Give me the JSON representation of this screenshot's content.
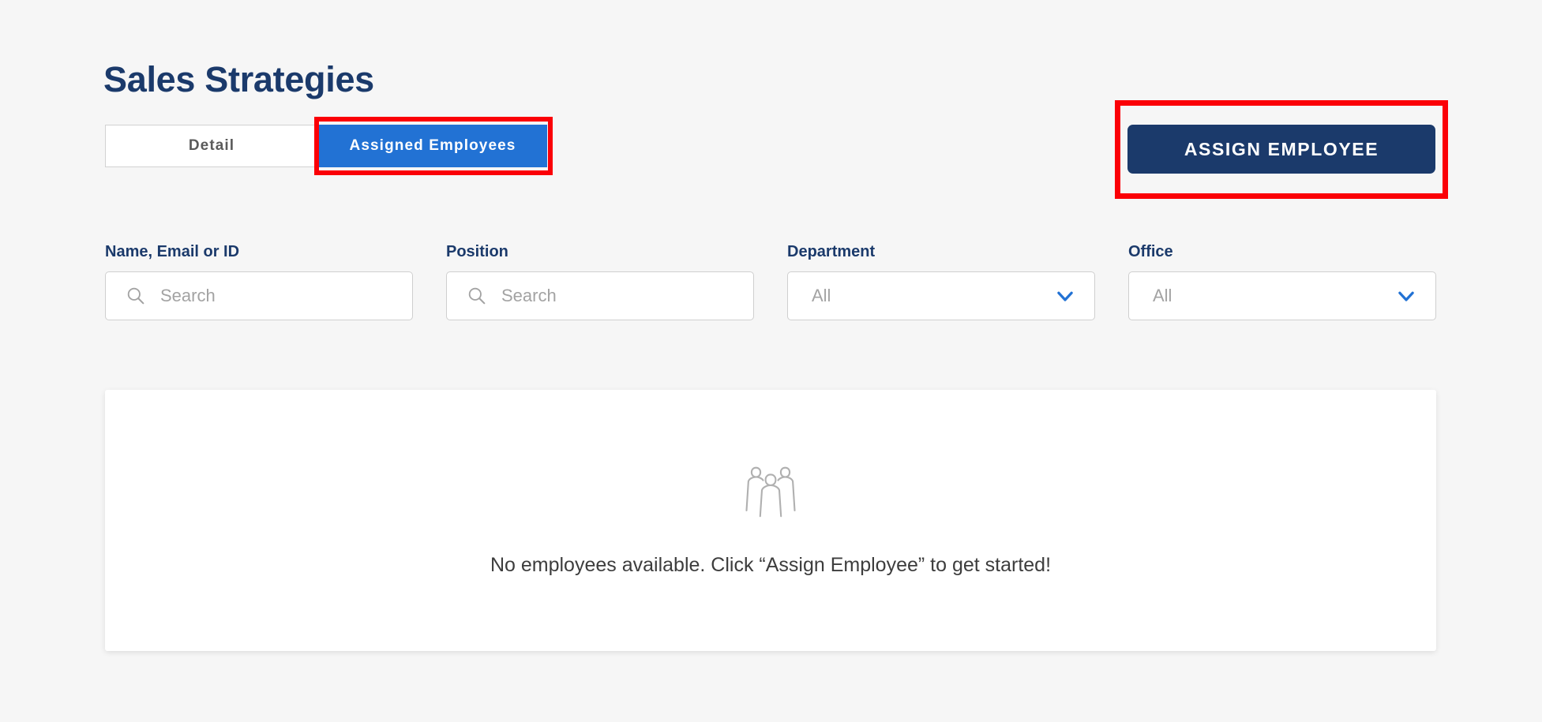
{
  "page": {
    "title": "Sales Strategies",
    "background_color": "#f6f6f6",
    "navy": "#1b3a6b",
    "accent_blue": "#2272d4",
    "annotation_color": "#fb0007"
  },
  "tabs": [
    {
      "label": "Detail",
      "active": false
    },
    {
      "label": "Assigned Employees",
      "active": true
    }
  ],
  "actions": {
    "assign_employee_label": "Assign Employee"
  },
  "filters": [
    {
      "label": "Name, Email or ID",
      "type": "search",
      "value": "",
      "placeholder": "Search",
      "icon": "search-icon"
    },
    {
      "label": "Position",
      "type": "search",
      "value": "",
      "placeholder": "Search",
      "icon": "search-icon"
    },
    {
      "label": "Department",
      "type": "select",
      "value": "All",
      "icon": "chevron-down-icon"
    },
    {
      "label": "Office",
      "type": "select",
      "value": "All",
      "icon": "chevron-down-icon"
    }
  ],
  "empty_state": {
    "icon": "three-people-icon",
    "message": "No employees available. Click “Assign Employee” to get started!"
  }
}
